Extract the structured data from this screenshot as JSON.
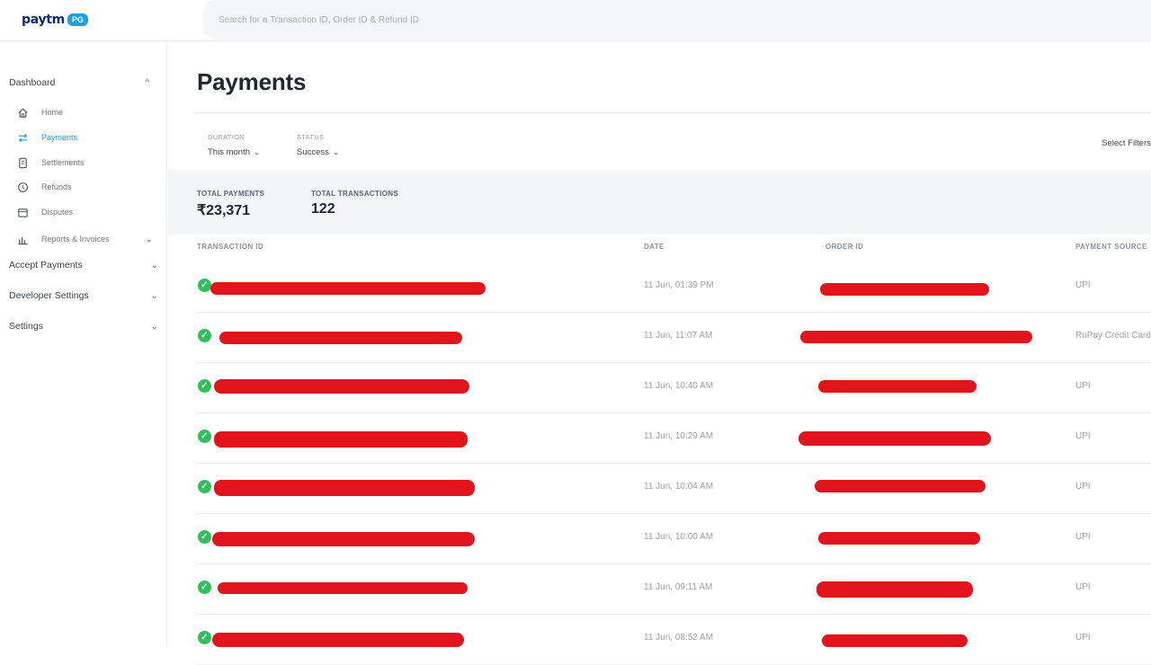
{
  "header": {
    "logo_text": "paytm",
    "logo_badge": "PG",
    "search_placeholder": "Search for a Transaction ID, Order ID & Refund ID"
  },
  "sidebar": {
    "dashboard": "Dashboard",
    "items": [
      {
        "label": "Home",
        "icon": "home-icon"
      },
      {
        "label": "Payments",
        "icon": "transfer-icon",
        "active": true
      },
      {
        "label": "Settlements",
        "icon": "document-icon"
      },
      {
        "label": "Refunds",
        "icon": "refund-icon"
      },
      {
        "label": "Disputes",
        "icon": "calendar-icon"
      },
      {
        "label": "Reports & Invoices",
        "icon": "bar-chart-icon"
      }
    ],
    "sections": [
      "Accept Payments",
      "Developer Settings",
      "Settings"
    ]
  },
  "main": {
    "title": "Payments",
    "filters": [
      {
        "label": "DURATION",
        "value": "This month"
      },
      {
        "label": "STATUS",
        "value": "Success"
      }
    ],
    "select_filters": "Select Filters",
    "summary": {
      "total_payments_label": "TOTAL PAYMENTS",
      "total_payments_value": "₹23,371",
      "total_transactions_label": "TOTAL TRANSACTIONS",
      "total_transactions_value": "122"
    },
    "columns": [
      "TRANSACTION ID",
      "DATE",
      "ORDER ID",
      "PAYMENT SOURCE"
    ],
    "rows": [
      {
        "date": "11 Jun, 01:39 PM",
        "source": "UPI"
      },
      {
        "date": "11 Jun, 11:07 AM",
        "source": "RuPay Credit Card"
      },
      {
        "date": "11 Jun, 10:40 AM",
        "source": "UPI"
      },
      {
        "date": "11 Jun, 10:29 AM",
        "source": "UPI"
      },
      {
        "date": "11 Jun, 10:04 AM",
        "source": "UPI"
      },
      {
        "date": "11 Jun, 10:00 AM",
        "source": "UPI"
      },
      {
        "date": "11 Jun, 09:11 AM",
        "source": "UPI"
      },
      {
        "date": "11 Jun, 08:52 AM",
        "source": "UPI"
      }
    ]
  },
  "colors": {
    "accent": "#1a9cdf",
    "success": "#2fbf5d",
    "redaction": "#e1141d"
  }
}
